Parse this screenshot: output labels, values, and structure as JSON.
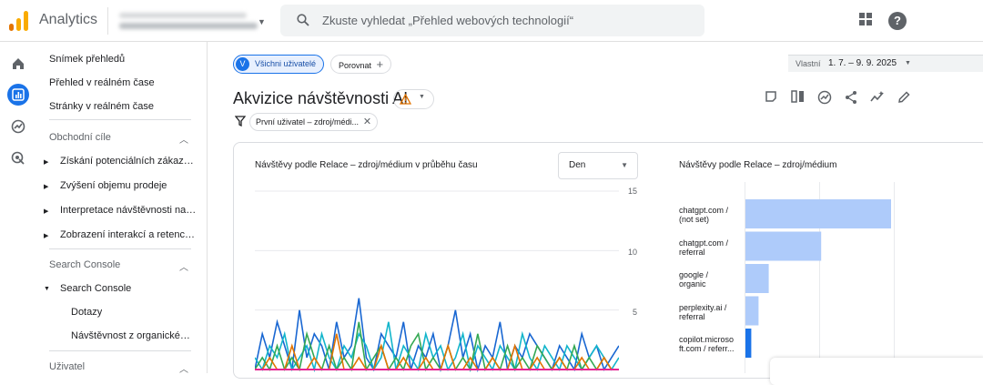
{
  "topbar": {
    "app_name": "Analytics",
    "search_placeholder": "Zkuste vyhledat „Přehled webových technologií“",
    "colors": {
      "logo_orange": "#f9ab00",
      "logo_dark": "#e37400"
    }
  },
  "nav": {
    "top_items": [
      "Snímek přehledů",
      "Přehled v reálném čase",
      "Stránky v reálném čase"
    ],
    "sections": [
      {
        "label": "Obchodní cíle",
        "items": [
          "Získání potenciálních zákazníků",
          "Zvýšení objemu prodeje",
          "Interpretace návštěvnosti na webu",
          "Zobrazení interakcí a retence uživatelů"
        ]
      },
      {
        "label": "Search Console",
        "group": "Search Console",
        "subitems": [
          "Dotazy",
          "Návštěvnost z organického vyhledávání"
        ]
      },
      {
        "label": "Uživatel"
      }
    ]
  },
  "main": {
    "segment_label": "Všichni uživatelé",
    "segment_initial": "V",
    "compare_label": "Porovnat",
    "date_prefix": "Vlastní",
    "date_range": "1. 7. – 9. 9. 2025",
    "title": "Akvizice návštěvnosti AI",
    "filter": "První uživatel – zdroj/médium",
    "filter_display": "První uživatel – zdroj/médi..."
  },
  "line_card": {
    "title": "Návštěvy podle Relace – zdroj/médium v průběhu času",
    "granularity": "Den",
    "y_ticks": [
      "15",
      "10",
      "5"
    ]
  },
  "bar_card": {
    "title": "Návštěvy podle Relace – zdroj/médium",
    "labels": [
      [
        "chatgpt.com /",
        "(not set)"
      ],
      [
        "chatgpt.com /",
        "referral"
      ],
      [
        "google /",
        "organic"
      ],
      [
        "perplexity.ai /",
        "referral"
      ],
      [
        "copilot.microso",
        "ft.com / referr..."
      ]
    ]
  },
  "chart_data": [
    {
      "type": "line",
      "title": "Návštěvy podle Relace – zdroj/médium v průběhu času",
      "ylim": [
        0,
        15
      ],
      "y_ticks": [
        5,
        10,
        15
      ],
      "series": [
        {
          "color": "#1967d2",
          "values": [
            0,
            3,
            1,
            4,
            2,
            0,
            5,
            1,
            3,
            2,
            0,
            4,
            1,
            2,
            6,
            1,
            0,
            3,
            2,
            1,
            4,
            0,
            2,
            1,
            3,
            0,
            2,
            5,
            1,
            3,
            0,
            2,
            1,
            4,
            0,
            2,
            1,
            3,
            2,
            1,
            0,
            2,
            1,
            0,
            3,
            1,
            2,
            0,
            1,
            2
          ]
        },
        {
          "color": "#12b5cb",
          "values": [
            1,
            0,
            2,
            1,
            3,
            0,
            1,
            2,
            0,
            3,
            1,
            0,
            2,
            1,
            3,
            2,
            0,
            1,
            4,
            0,
            2,
            1,
            0,
            3,
            1,
            2,
            0,
            1,
            3,
            0,
            2,
            1,
            0,
            2,
            1,
            0,
            3,
            1,
            0,
            2,
            1,
            0,
            2,
            1,
            0,
            1,
            2,
            1,
            0,
            1
          ]
        },
        {
          "color": "#34a853",
          "values": [
            0,
            1,
            0,
            2,
            0,
            1,
            0,
            3,
            1,
            0,
            2,
            0,
            1,
            0,
            4,
            0,
            1,
            2,
            0,
            1,
            0,
            2,
            3,
            0,
            1,
            0,
            2,
            0,
            1,
            0,
            3,
            0,
            1,
            0,
            2,
            0,
            1,
            0,
            2,
            1,
            0,
            1,
            0,
            2,
            0,
            1,
            0,
            1,
            0,
            0
          ]
        },
        {
          "color": "#e37400",
          "values": [
            0,
            0,
            1,
            0,
            0,
            2,
            0,
            0,
            1,
            0,
            0,
            3,
            0,
            0,
            1,
            0,
            0,
            2,
            0,
            0,
            1,
            0,
            0,
            1,
            0,
            0,
            2,
            0,
            0,
            1,
            0,
            0,
            1,
            0,
            0,
            2,
            0,
            0,
            1,
            0,
            0,
            1,
            0,
            0,
            1,
            0,
            0,
            1,
            0,
            0
          ]
        },
        {
          "color": "#e52592",
          "values": [
            0,
            0,
            0,
            0,
            0,
            0,
            0,
            0,
            0,
            0,
            0,
            0,
            0,
            0,
            0,
            0,
            0,
            0,
            0,
            0,
            0,
            0,
            0,
            0,
            0,
            0,
            0,
            0,
            0,
            0,
            0,
            0,
            0,
            0,
            0,
            0,
            0,
            0,
            0,
            0,
            0,
            0,
            0,
            0,
            0,
            0,
            0,
            0,
            0,
            0
          ]
        }
      ]
    },
    {
      "type": "bar",
      "title": "Návštěvy podle Relace – zdroj/médium",
      "categories": [
        "chatgpt.com / (not set)",
        "chatgpt.com / referral",
        "google / organic",
        "perplexity.ai / referral",
        "copilot.microsoft.com / referral"
      ],
      "values": [
        100,
        52,
        16,
        9,
        4
      ],
      "colors": [
        "#aecbfa",
        "#aecbfa",
        "#aecbfa",
        "#aecbfa",
        "#1a73e8"
      ]
    }
  ]
}
